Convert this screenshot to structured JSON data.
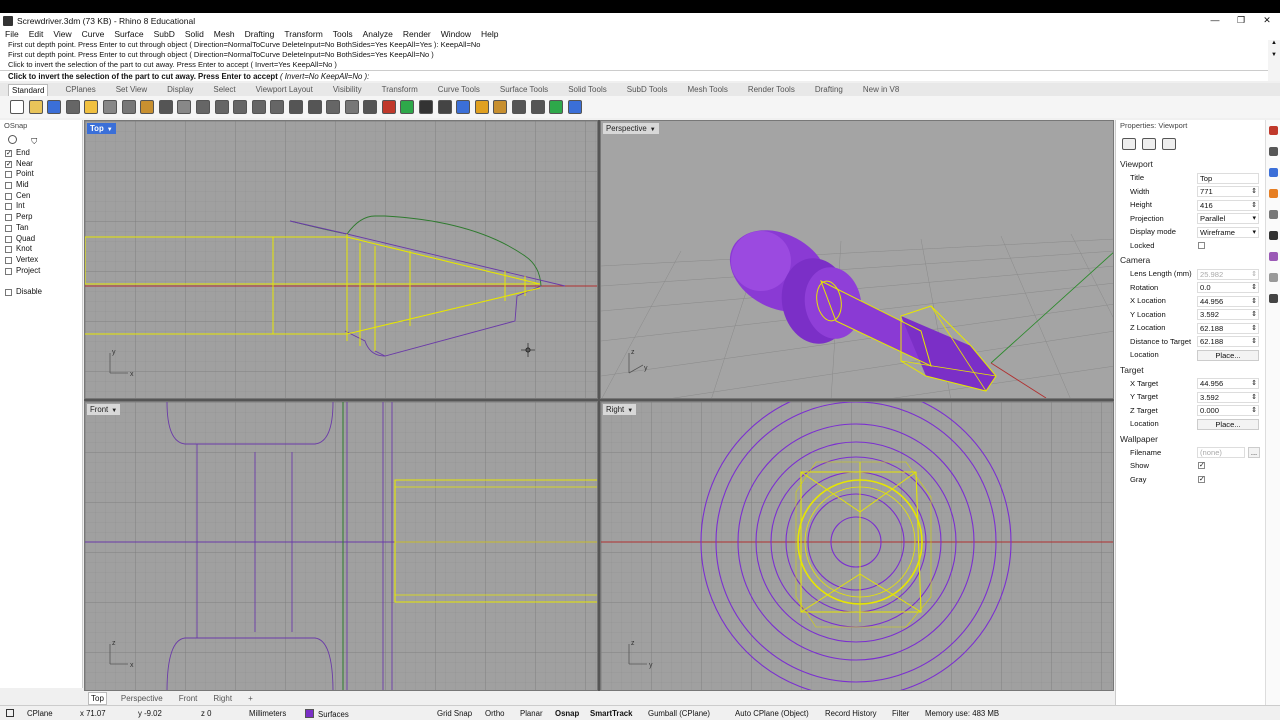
{
  "window": {
    "title": "Screwdriver.3dm (73 KB) - Rhino 8 Educational",
    "min": "—",
    "max": "❐",
    "close": "✕"
  },
  "menu": [
    "File",
    "Edit",
    "View",
    "Curve",
    "Surface",
    "SubD",
    "Solid",
    "Mesh",
    "Drafting",
    "Transform",
    "Tools",
    "Analyze",
    "Render",
    "Window",
    "Help"
  ],
  "command_history": [
    "First cut depth point. Press Enter to cut through object ( Direction=NormalToCurve  DeleteInput=No  BothSides=Yes  KeepAll=Yes ): KeepAll=No",
    "First cut depth point. Press Enter to cut through object ( Direction=NormalToCurve  DeleteInput=No  BothSides=Yes  KeepAll=No )",
    "Click to invert the selection of the part to cut away. Press Enter to accept ( Invert=Yes  KeepAll=No )"
  ],
  "command_prompt": "Click to invert the selection of the part to cut away. Press Enter to accept",
  "command_options": "( Invert=No  KeepAll=No ):",
  "toolbar_tabs": [
    "Standard",
    "CPlanes",
    "Set View",
    "Display",
    "Select",
    "Viewport Layout",
    "Visibility",
    "Transform",
    "Curve Tools",
    "Surface Tools",
    "Solid Tools",
    "SubD Tools",
    "Mesh Tools",
    "Render Tools",
    "Drafting",
    "New in V8"
  ],
  "toolbar_icons": [
    "new-icon",
    "open-icon",
    "save-icon",
    "print-icon",
    "import-icon",
    "cut-icon",
    "copy-icon",
    "paste-icon",
    "undo-icon",
    "pan-icon",
    "move-icon",
    "zoom-icon",
    "zoom-window-icon",
    "zoom-extents-icon",
    "rotate-view-icon",
    "viewports-icon",
    "named-views-icon",
    "camera-icon",
    "target-icon",
    "lock-icon",
    "layer-icon",
    "color-icon",
    "sphere-shaded-icon",
    "sphere-wire-icon",
    "render-icon",
    "light-icon",
    "gear-icon",
    "grid-icon",
    "ortho-icon",
    "earth-icon",
    "help-icon"
  ],
  "osnap": {
    "title": "OSnap",
    "items": [
      {
        "label": "End",
        "checked": true
      },
      {
        "label": "Near",
        "checked": true
      },
      {
        "label": "Point",
        "checked": false
      },
      {
        "label": "Mid",
        "checked": false
      },
      {
        "label": "Cen",
        "checked": false
      },
      {
        "label": "Int",
        "checked": false
      },
      {
        "label": "Perp",
        "checked": false
      },
      {
        "label": "Tan",
        "checked": false
      },
      {
        "label": "Quad",
        "checked": false
      },
      {
        "label": "Knot",
        "checked": false
      },
      {
        "label": "Vertex",
        "checked": false
      },
      {
        "label": "Project",
        "checked": false
      }
    ],
    "disable": "Disable"
  },
  "viewports": {
    "top": "Top",
    "perspective": "Perspective",
    "front": "Front",
    "right": "Right",
    "axis_x": "x",
    "axis_y": "y",
    "axis_z": "z"
  },
  "viewport_tabs": [
    "Top",
    "Perspective",
    "Front",
    "Right",
    "+"
  ],
  "properties": {
    "title": "Properties: Viewport",
    "viewport_section": "Viewport",
    "viewport_rows": [
      {
        "key": "Title",
        "value": "Top",
        "kind": "text"
      },
      {
        "key": "Width",
        "value": "771",
        "kind": "spin"
      },
      {
        "key": "Height",
        "value": "416",
        "kind": "spin"
      },
      {
        "key": "Projection",
        "value": "Parallel",
        "kind": "select"
      },
      {
        "key": "Display mode",
        "value": "Wireframe",
        "kind": "select"
      }
    ],
    "locked": "Locked",
    "camera_section": "Camera",
    "camera_rows": [
      {
        "key": "Lens Length (mm)",
        "value": "25.982",
        "kind": "dim"
      },
      {
        "key": "Rotation",
        "value": "0.0",
        "kind": "spin"
      },
      {
        "key": "X Location",
        "value": "44.956",
        "kind": "spin"
      },
      {
        "key": "Y Location",
        "value": "3.592",
        "kind": "spin"
      },
      {
        "key": "Z Location",
        "value": "62.188",
        "kind": "spin"
      },
      {
        "key": "Distance to Target",
        "value": "62.188",
        "kind": "spin"
      }
    ],
    "location": "Location",
    "place": "Place...",
    "target_section": "Target",
    "target_rows": [
      {
        "key": "X Target",
        "value": "44.956",
        "kind": "spin"
      },
      {
        "key": "Y Target",
        "value": "3.592",
        "kind": "spin"
      },
      {
        "key": "Z Target",
        "value": "0.000",
        "kind": "spin"
      }
    ],
    "wallpaper_section": "Wallpaper",
    "filename": "Filename",
    "filename_value": "(none)",
    "browse": "...",
    "show": "Show",
    "gray": "Gray",
    "check": "✓"
  },
  "statusbar": {
    "cplane": "CPlane",
    "x": "x 71.07",
    "y": "y -9.02",
    "z": "z 0",
    "units": "Millimeters",
    "layer": "Surfaces",
    "grid_snap": "Grid Snap",
    "ortho": "Ortho",
    "planar": "Planar",
    "osnap": "Osnap",
    "smarttrack": "SmartTrack",
    "gumball": "Gumball (CPlane)",
    "auto_cplane": "Auto CPlane (Object)",
    "record_history": "Record History",
    "filter": "Filter",
    "memory": "Memory use: 483 MB"
  },
  "colors": {
    "selected": "#e6e600",
    "purple": "#7b2fd0",
    "accent": "#3a6fd8"
  }
}
